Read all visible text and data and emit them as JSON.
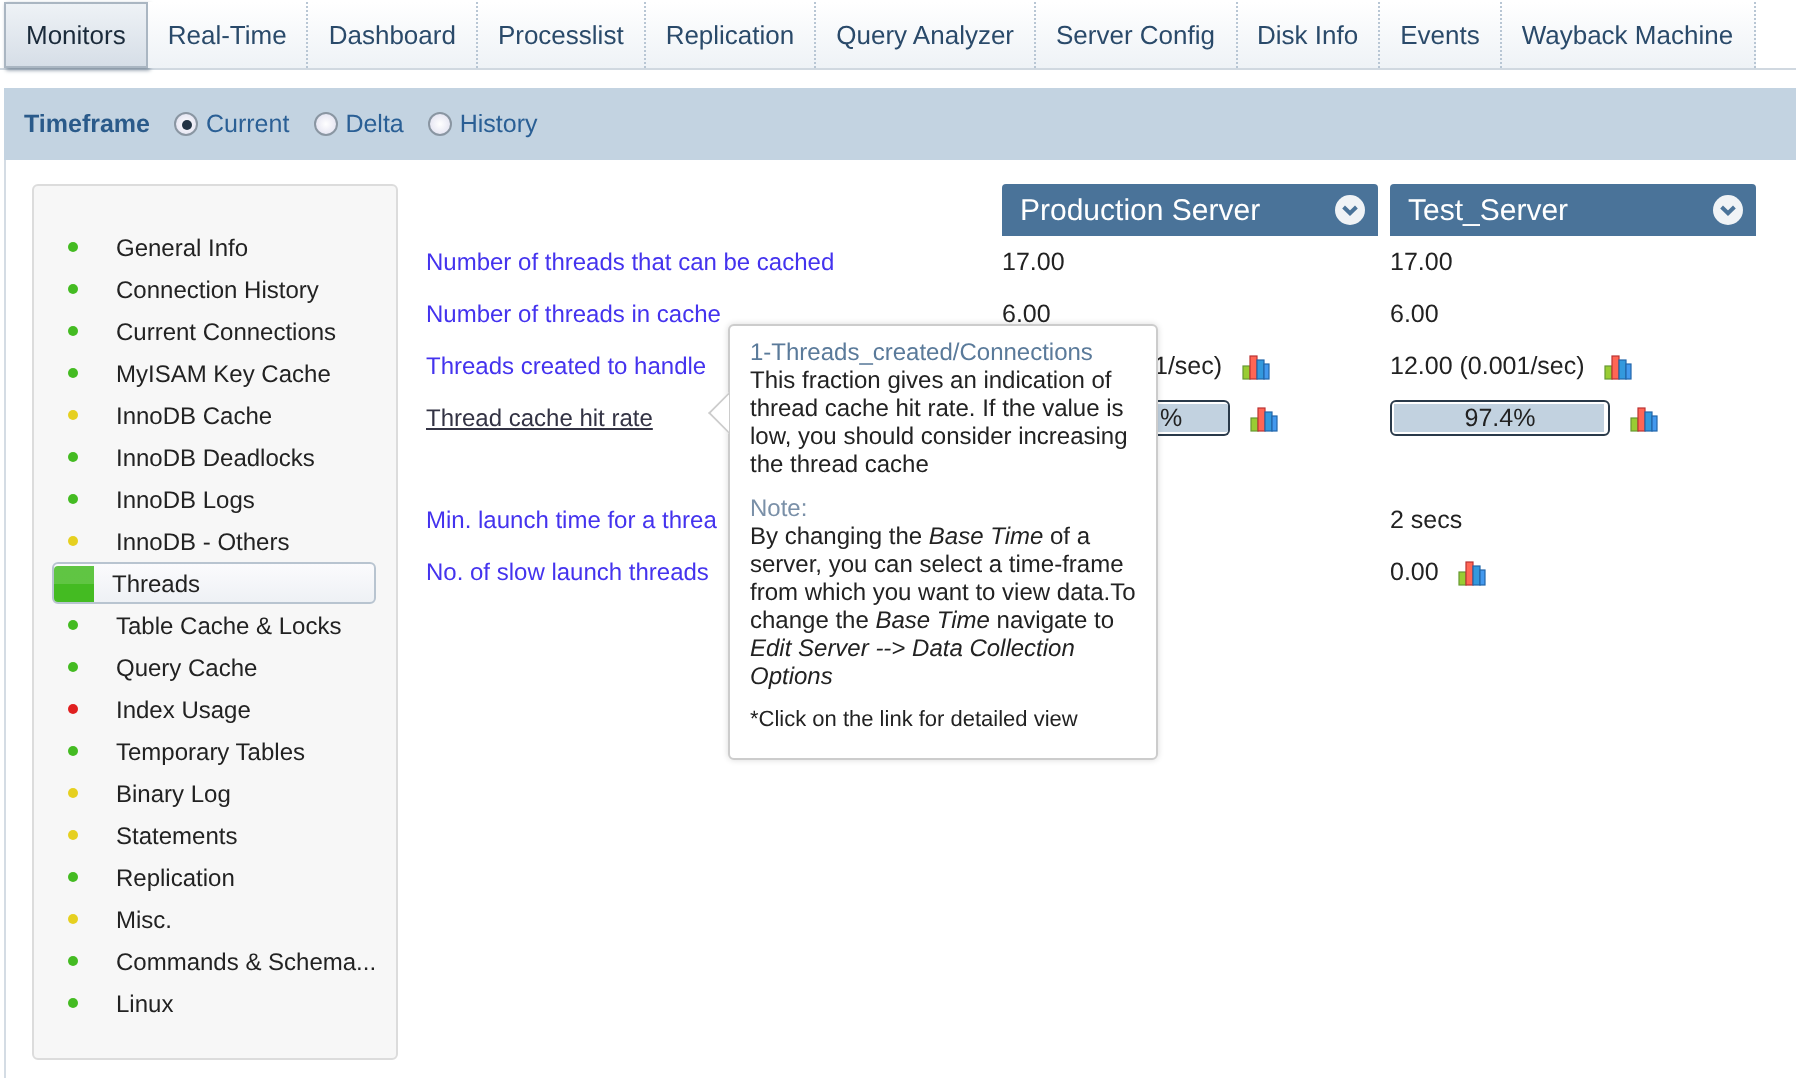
{
  "tabs": [
    {
      "label": "Monitors",
      "selected": true
    },
    {
      "label": "Real-Time",
      "selected": false
    },
    {
      "label": "Dashboard",
      "selected": false
    },
    {
      "label": "Processlist",
      "selected": false
    },
    {
      "label": "Replication",
      "selected": false
    },
    {
      "label": "Query Analyzer",
      "selected": false
    },
    {
      "label": "Server Config",
      "selected": false
    },
    {
      "label": "Disk Info",
      "selected": false
    },
    {
      "label": "Events",
      "selected": false
    },
    {
      "label": "Wayback Machine",
      "selected": false
    }
  ],
  "timeframe": {
    "label": "Timeframe",
    "options": [
      {
        "label": "Current",
        "selected": true
      },
      {
        "label": "Delta",
        "selected": false
      },
      {
        "label": "History",
        "selected": false
      }
    ]
  },
  "sidebar": {
    "items": [
      {
        "label": "General Info",
        "color": "#44bb22",
        "selected": false
      },
      {
        "label": "Connection History",
        "color": "#44bb22",
        "selected": false
      },
      {
        "label": "Current Connections",
        "color": "#44bb22",
        "selected": false
      },
      {
        "label": "MyISAM Key Cache",
        "color": "#44bb22",
        "selected": false
      },
      {
        "label": "InnoDB Cache",
        "color": "#e6d020",
        "selected": false
      },
      {
        "label": "InnoDB Deadlocks",
        "color": "#44bb22",
        "selected": false
      },
      {
        "label": "InnoDB Logs",
        "color": "#44bb22",
        "selected": false
      },
      {
        "label": "InnoDB - Others",
        "color": "#e6d020",
        "selected": false
      },
      {
        "label": "Threads",
        "color": "#44bb22",
        "selected": true
      },
      {
        "label": "Table Cache & Locks",
        "color": "#44bb22",
        "selected": false
      },
      {
        "label": "Query Cache",
        "color": "#44bb22",
        "selected": false
      },
      {
        "label": "Index Usage",
        "color": "#e02020",
        "selected": false
      },
      {
        "label": "Temporary Tables",
        "color": "#44bb22",
        "selected": false
      },
      {
        "label": "Binary Log",
        "color": "#e6d020",
        "selected": false
      },
      {
        "label": "Statements",
        "color": "#e6d020",
        "selected": false
      },
      {
        "label": "Replication",
        "color": "#44bb22",
        "selected": false
      },
      {
        "label": "Misc.",
        "color": "#e6d020",
        "selected": false
      },
      {
        "label": "Commands & Schema...",
        "color": "#44bb22",
        "selected": false
      },
      {
        "label": "Linux",
        "color": "#44bb22",
        "selected": false
      }
    ]
  },
  "servers": [
    {
      "name": "Production Server"
    },
    {
      "name": "Test_Server"
    }
  ],
  "metric_groups": [
    [
      {
        "label": "Number of threads that can be cached",
        "hovered": false,
        "cells": [
          {
            "kind": "text",
            "value": "17.00",
            "chart_icon": false
          },
          {
            "kind": "text",
            "value": "17.00",
            "chart_icon": false
          }
        ]
      },
      {
        "label": "Number of threads in cache",
        "hovered": false,
        "cells": [
          {
            "kind": "text",
            "value": "6.00",
            "chart_icon": false
          },
          {
            "kind": "text",
            "value": "6.00",
            "chart_icon": false
          }
        ]
      },
      {
        "label": "Threads created to handle",
        "hovered": false,
        "cells": [
          {
            "kind": "text",
            "value": "1/sec)",
            "chart_icon": true,
            "covered": true
          },
          {
            "kind": "text",
            "value": "12.00 (0.001/sec)",
            "chart_icon": true
          }
        ]
      },
      {
        "label": "Thread cache hit rate",
        "hovered": true,
        "cells": [
          {
            "kind": "meter",
            "value": "%",
            "level": 1,
            "chart_icon": true,
            "covered": true
          },
          {
            "kind": "meter",
            "value": "97.4%",
            "level": 0.974,
            "chart_icon": true
          }
        ]
      }
    ],
    [
      {
        "label": "Min. launch time for a threa",
        "hovered": false,
        "cells": [
          null,
          {
            "kind": "text",
            "value": "2 secs",
            "chart_icon": false
          }
        ]
      },
      {
        "label": "No. of slow launch threads",
        "hovered": false,
        "cells": [
          null,
          {
            "kind": "text",
            "value": "0.00",
            "chart_icon": true
          }
        ]
      }
    ]
  ],
  "tooltip": {
    "title": "1-Threads_created/Connections",
    "body": "This fraction gives an indication of thread cache hit rate. If the value is low, you should consider increasing the thread cache",
    "note_label": "Note:",
    "note": "By changing the *Base Time* of a server, you can select a time-frame from which you want to view data.To change the *Base Time* navigate to *Edit Server --> Data Collection Options*",
    "footer": "*Click on the link for detailed view"
  }
}
